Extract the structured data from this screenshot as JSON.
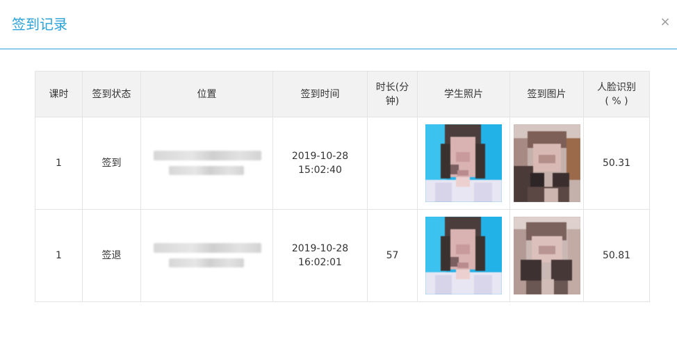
{
  "dialog": {
    "title": "签到记录",
    "close_label": "×"
  },
  "table": {
    "headers": {
      "lesson": "课时",
      "status": "签到状态",
      "location": "位置",
      "time": "签到时间",
      "duration_line1": "时长(分",
      "duration_line2": "钟)",
      "student_photo": "学生照片",
      "checkin_photo": "签到图片",
      "face_line1": "人脸识别",
      "face_line2": "( % )"
    },
    "rows": [
      {
        "lesson": "1",
        "status": "签到",
        "date": "2019-10-28",
        "clock": "15:02:40",
        "duration": "",
        "face_score": "50.31"
      },
      {
        "lesson": "1",
        "status": "签退",
        "date": "2019-10-28",
        "clock": "16:02:01",
        "duration": "57",
        "face_score": "50.81"
      }
    ]
  },
  "colors": {
    "accent": "#2aa1d8",
    "header_bg": "#f2f2f2",
    "border": "#e3e3e3",
    "student_photo_bg": "#1fb0e6"
  }
}
